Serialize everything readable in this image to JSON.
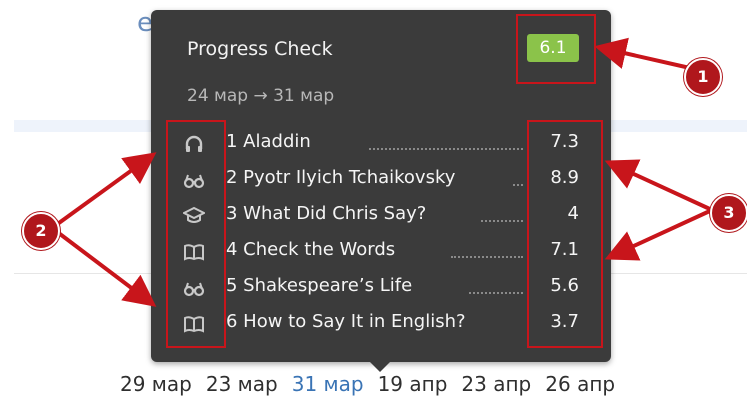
{
  "tooltip": {
    "title": "Progress Check",
    "score": "6.1",
    "score_color": "#8bc34a",
    "date_range": "24 мар → 31 мар",
    "items": [
      {
        "label": "1 Aladdin",
        "value": "7.3",
        "icon": "headphones-icon"
      },
      {
        "label": "2 Pyotr Ilyich Tchaikovsky",
        "value": "8.9",
        "icon": "glasses-icon"
      },
      {
        "label": "3 What Did Chris Say?",
        "value": "4",
        "icon": "graduation-cap-icon"
      },
      {
        "label": "4 Check the Words",
        "value": "7.1",
        "icon": "book-icon"
      },
      {
        "label": "5 Shakespeare’s Life",
        "value": "5.6",
        "icon": "glasses-icon"
      },
      {
        "label": "6 How to Say It in English?",
        "value": "3.7",
        "icon": "book-icon"
      }
    ]
  },
  "annotations": {
    "markers": [
      {
        "number": "1"
      },
      {
        "number": "2"
      },
      {
        "number": "3"
      }
    ],
    "color": "#c8151b"
  },
  "timeline": {
    "dates": [
      "29 мар",
      "23 мар",
      "31 мар",
      "19 апр",
      "23 апр",
      "26 апр"
    ],
    "active_date": "31 мар",
    "active_color": "#3a74b5"
  }
}
